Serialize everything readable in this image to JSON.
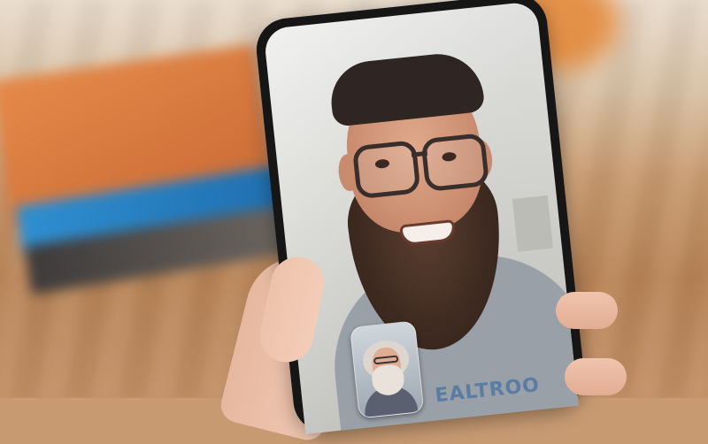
{
  "scene": {
    "background_colors": {
      "floor_wood": "#c89a6f",
      "book_orange": "#e58a4a",
      "book_blue": "#2f8fd1",
      "blob_orange": "#e48a3c"
    }
  },
  "phone": {
    "body_color": "#161616",
    "video_call": {
      "remote_shirt_text": "EALTROO",
      "shirt_color": "#9aa0a8",
      "shirt_text_color": "#5b7ca3",
      "self_view": {
        "label": "",
        "bg_color": "#9ea7b0"
      }
    }
  }
}
